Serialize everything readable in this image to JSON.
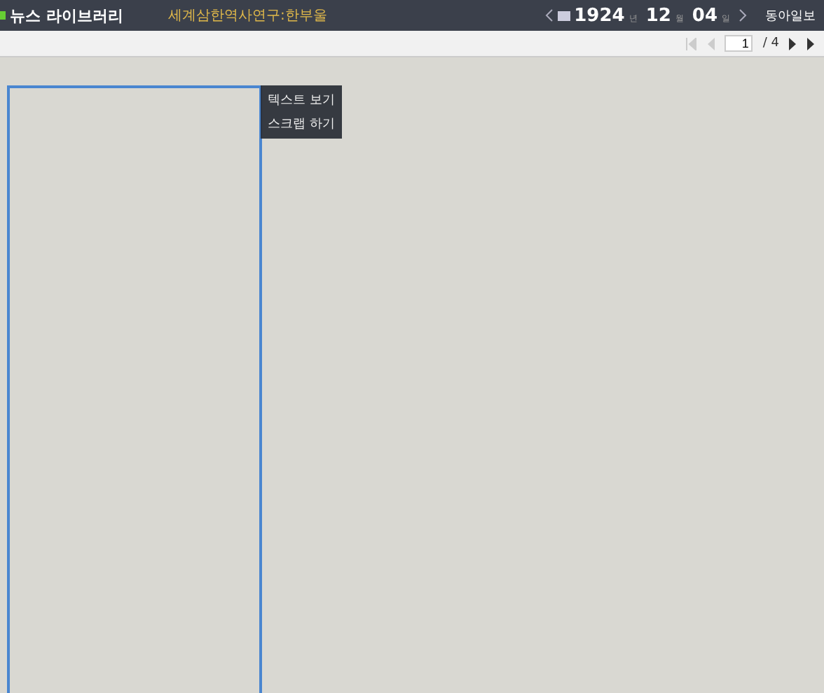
{
  "header": {
    "logo": "뉴스 라이브러리",
    "breadcrumb": "세계삼한역사연구:한부울",
    "date": [
      {
        "value": "1924",
        "unit": "년"
      },
      {
        "value": "12",
        "unit": "월"
      },
      {
        "value": "04",
        "unit": "일"
      }
    ],
    "publisher": "동아일보"
  },
  "pager": {
    "page": "1",
    "total": "/ 4"
  },
  "context_menu": {
    "items": [
      "텍스트 보기",
      "스크랩 하기"
    ]
  }
}
